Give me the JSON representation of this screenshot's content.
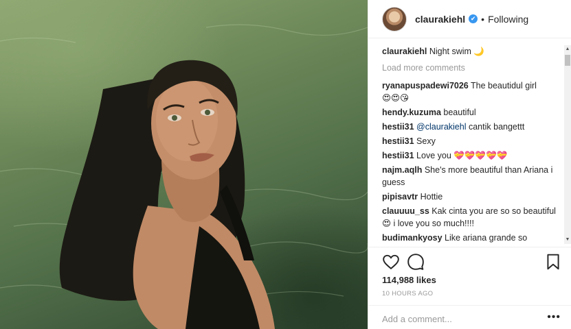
{
  "photo": {
    "subject": "woman-in-pool-photo"
  },
  "header": {
    "username": "claurakiehl",
    "verified_mark": "✔",
    "separator": "•",
    "follow_status": "Following"
  },
  "caption": {
    "user": "claurakiehl",
    "text": "Night swim",
    "emoji": "🌙"
  },
  "load_more": "Load more comments",
  "comments": [
    {
      "user": "ryanapuspadewi7026",
      "text": "The beautidul girl",
      "emoji": "😍😍😘"
    },
    {
      "user": "hendy.kuzuma",
      "text": "beautiful"
    },
    {
      "user": "hestii31",
      "mention": "@claurakiehl",
      "text": "cantik bangettt"
    },
    {
      "user": "hestii31",
      "text": "Sexy"
    },
    {
      "user": "hestii31",
      "text": "Love you",
      "emoji": "💝💝💝💝💝"
    },
    {
      "user": "najm.aqlh",
      "text": "She's more beautiful than Ariana i guess"
    },
    {
      "user": "pipisavtr",
      "text": "Hottie"
    },
    {
      "user": "clauuuu_ss",
      "text": "Kak cinta you are so so beautiful",
      "emoji": "😍",
      "text2": "i love you so much!!!!"
    },
    {
      "user": "budimankyosy",
      "text": "Like ariana grande so"
    }
  ],
  "scrollbar": {
    "up": "▲",
    "down": "▼"
  },
  "actions": {
    "icons": [
      "heart-icon",
      "comment-icon",
      "bookmark-icon"
    ],
    "likes": "114,988 likes",
    "time": "10 HOURS AGO"
  },
  "add_comment": {
    "placeholder": "Add a comment...",
    "more_label": "•••"
  },
  "colors": {
    "link": "#003569",
    "verified": "#3897f0",
    "muted": "#999999",
    "text": "#262626",
    "heart": "#ed4956"
  }
}
